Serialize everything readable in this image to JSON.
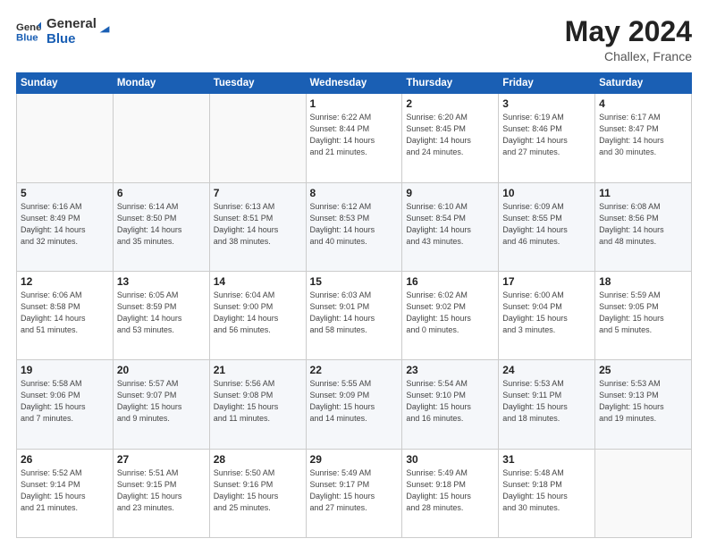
{
  "header": {
    "logo_line1": "General",
    "logo_line2": "Blue",
    "month_year": "May 2024",
    "location": "Challex, France"
  },
  "weekdays": [
    "Sunday",
    "Monday",
    "Tuesday",
    "Wednesday",
    "Thursday",
    "Friday",
    "Saturday"
  ],
  "weeks": [
    [
      {
        "day": "",
        "info": ""
      },
      {
        "day": "",
        "info": ""
      },
      {
        "day": "",
        "info": ""
      },
      {
        "day": "1",
        "info": "Sunrise: 6:22 AM\nSunset: 8:44 PM\nDaylight: 14 hours\nand 21 minutes."
      },
      {
        "day": "2",
        "info": "Sunrise: 6:20 AM\nSunset: 8:45 PM\nDaylight: 14 hours\nand 24 minutes."
      },
      {
        "day": "3",
        "info": "Sunrise: 6:19 AM\nSunset: 8:46 PM\nDaylight: 14 hours\nand 27 minutes."
      },
      {
        "day": "4",
        "info": "Sunrise: 6:17 AM\nSunset: 8:47 PM\nDaylight: 14 hours\nand 30 minutes."
      }
    ],
    [
      {
        "day": "5",
        "info": "Sunrise: 6:16 AM\nSunset: 8:49 PM\nDaylight: 14 hours\nand 32 minutes."
      },
      {
        "day": "6",
        "info": "Sunrise: 6:14 AM\nSunset: 8:50 PM\nDaylight: 14 hours\nand 35 minutes."
      },
      {
        "day": "7",
        "info": "Sunrise: 6:13 AM\nSunset: 8:51 PM\nDaylight: 14 hours\nand 38 minutes."
      },
      {
        "day": "8",
        "info": "Sunrise: 6:12 AM\nSunset: 8:53 PM\nDaylight: 14 hours\nand 40 minutes."
      },
      {
        "day": "9",
        "info": "Sunrise: 6:10 AM\nSunset: 8:54 PM\nDaylight: 14 hours\nand 43 minutes."
      },
      {
        "day": "10",
        "info": "Sunrise: 6:09 AM\nSunset: 8:55 PM\nDaylight: 14 hours\nand 46 minutes."
      },
      {
        "day": "11",
        "info": "Sunrise: 6:08 AM\nSunset: 8:56 PM\nDaylight: 14 hours\nand 48 minutes."
      }
    ],
    [
      {
        "day": "12",
        "info": "Sunrise: 6:06 AM\nSunset: 8:58 PM\nDaylight: 14 hours\nand 51 minutes."
      },
      {
        "day": "13",
        "info": "Sunrise: 6:05 AM\nSunset: 8:59 PM\nDaylight: 14 hours\nand 53 minutes."
      },
      {
        "day": "14",
        "info": "Sunrise: 6:04 AM\nSunset: 9:00 PM\nDaylight: 14 hours\nand 56 minutes."
      },
      {
        "day": "15",
        "info": "Sunrise: 6:03 AM\nSunset: 9:01 PM\nDaylight: 14 hours\nand 58 minutes."
      },
      {
        "day": "16",
        "info": "Sunrise: 6:02 AM\nSunset: 9:02 PM\nDaylight: 15 hours\nand 0 minutes."
      },
      {
        "day": "17",
        "info": "Sunrise: 6:00 AM\nSunset: 9:04 PM\nDaylight: 15 hours\nand 3 minutes."
      },
      {
        "day": "18",
        "info": "Sunrise: 5:59 AM\nSunset: 9:05 PM\nDaylight: 15 hours\nand 5 minutes."
      }
    ],
    [
      {
        "day": "19",
        "info": "Sunrise: 5:58 AM\nSunset: 9:06 PM\nDaylight: 15 hours\nand 7 minutes."
      },
      {
        "day": "20",
        "info": "Sunrise: 5:57 AM\nSunset: 9:07 PM\nDaylight: 15 hours\nand 9 minutes."
      },
      {
        "day": "21",
        "info": "Sunrise: 5:56 AM\nSunset: 9:08 PM\nDaylight: 15 hours\nand 11 minutes."
      },
      {
        "day": "22",
        "info": "Sunrise: 5:55 AM\nSunset: 9:09 PM\nDaylight: 15 hours\nand 14 minutes."
      },
      {
        "day": "23",
        "info": "Sunrise: 5:54 AM\nSunset: 9:10 PM\nDaylight: 15 hours\nand 16 minutes."
      },
      {
        "day": "24",
        "info": "Sunrise: 5:53 AM\nSunset: 9:11 PM\nDaylight: 15 hours\nand 18 minutes."
      },
      {
        "day": "25",
        "info": "Sunrise: 5:53 AM\nSunset: 9:13 PM\nDaylight: 15 hours\nand 19 minutes."
      }
    ],
    [
      {
        "day": "26",
        "info": "Sunrise: 5:52 AM\nSunset: 9:14 PM\nDaylight: 15 hours\nand 21 minutes."
      },
      {
        "day": "27",
        "info": "Sunrise: 5:51 AM\nSunset: 9:15 PM\nDaylight: 15 hours\nand 23 minutes."
      },
      {
        "day": "28",
        "info": "Sunrise: 5:50 AM\nSunset: 9:16 PM\nDaylight: 15 hours\nand 25 minutes."
      },
      {
        "day": "29",
        "info": "Sunrise: 5:49 AM\nSunset: 9:17 PM\nDaylight: 15 hours\nand 27 minutes."
      },
      {
        "day": "30",
        "info": "Sunrise: 5:49 AM\nSunset: 9:18 PM\nDaylight: 15 hours\nand 28 minutes."
      },
      {
        "day": "31",
        "info": "Sunrise: 5:48 AM\nSunset: 9:18 PM\nDaylight: 15 hours\nand 30 minutes."
      },
      {
        "day": "",
        "info": ""
      }
    ]
  ]
}
